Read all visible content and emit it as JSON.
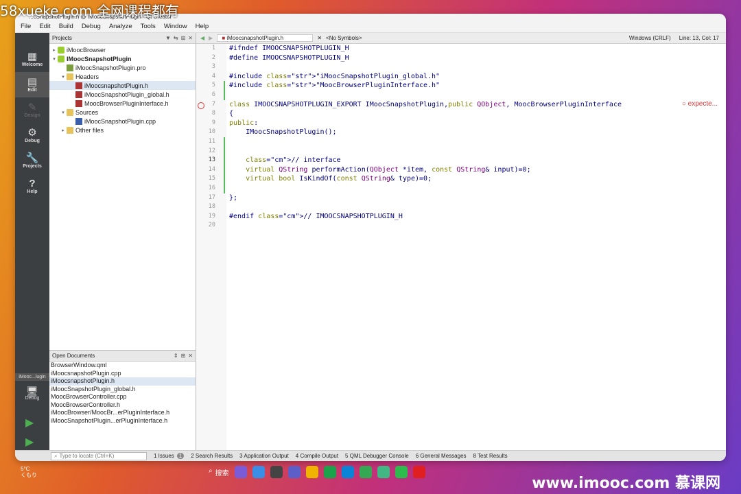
{
  "watermark_top": "58xueke.com 全网课程都有",
  "window_title": "...cSnapshotPlugin.h @ IMoocSnapshotPlugin - Qt Creator",
  "menu": [
    "File",
    "Edit",
    "Build",
    "Debug",
    "Analyze",
    "Tools",
    "Window",
    "Help"
  ],
  "modes": [
    {
      "label": "Welcome",
      "icon": "▦"
    },
    {
      "label": "Edit",
      "icon": "▤"
    },
    {
      "label": "Design",
      "icon": "✎"
    },
    {
      "label": "Debug",
      "icon": "⚙"
    },
    {
      "label": "Projects",
      "icon": "🔧"
    },
    {
      "label": "Help",
      "icon": "?"
    }
  ],
  "kit": {
    "label": "iMooc...lugin",
    "mode": "Debug"
  },
  "projects_panel": {
    "title": "Projects"
  },
  "tree": [
    {
      "text": "iMoocBrowser",
      "indent": 0,
      "arrow": "▸",
      "icon": "project"
    },
    {
      "text": "IMoocSnapshotPlugin",
      "indent": 0,
      "arrow": "▾",
      "icon": "project",
      "bold": true
    },
    {
      "text": "iMoocSnapshotPlugin.pro",
      "indent": 1,
      "arrow": "",
      "icon": "profile"
    },
    {
      "text": "Headers",
      "indent": 1,
      "arrow": "▾",
      "icon": "folder"
    },
    {
      "text": "iMoocsnapshotPlugin.h",
      "indent": 2,
      "arrow": "",
      "icon": "hfile",
      "selected": true
    },
    {
      "text": "iMoocSnapshotPlugin_global.h",
      "indent": 2,
      "arrow": "",
      "icon": "hfile"
    },
    {
      "text": "MoocBrowserPluginInterface.h",
      "indent": 2,
      "arrow": "",
      "icon": "hfile"
    },
    {
      "text": "Sources",
      "indent": 1,
      "arrow": "▾",
      "icon": "folder"
    },
    {
      "text": "iMoocSnapshotPlugin.cpp",
      "indent": 2,
      "arrow": "",
      "icon": "cppfile"
    },
    {
      "text": "Other files",
      "indent": 1,
      "arrow": "▸",
      "icon": "folder"
    }
  ],
  "open_documents": {
    "title": "Open Documents",
    "items": [
      "BrowserWindow.qml",
      "iMoocsnapshotPlugin.cpp",
      "iMoocsnapshotPlugin.h",
      "iMoocSnapshotPlugin_global.h",
      "MoocBrowserController.cpp",
      "MoocBrowserController.h",
      "iMoocBrowser/MoocBr...erPluginInterface.h",
      "iMoocSnapshotPlugin...erPluginInterface.h"
    ]
  },
  "editor": {
    "file": "iMoocsnapshotPlugin.h",
    "symbols": "<No Symbols>",
    "line_ending": "Windows (CRLF)",
    "position": "Line: 13, Col: 17",
    "error_hint": "expecte...",
    "current_line": 13,
    "lines": [
      "#ifndef IMOOCSNAPSHOTPLUGIN_H",
      "#define IMOOCSNAPSHOTPLUGIN_H",
      "",
      "#include \"iMoocSnapshotPlugin_global.h\"",
      "#include \"MoocBrowserPluginInterface.h\"",
      "",
      "class IMOOCSNAPSHOTPLUGIN_EXPORT IMoocSnapshotPlugin,public QObject, MoocBrowserPluginInterface",
      "{",
      "public:",
      "    IMoocSnapshotPlugin();",
      "",
      "",
      "    // interface",
      "    virtual QString performAction(QObject *item, const QString& input)=0;",
      "    virtual bool IsKindOf(const QString& type)=0;",
      "",
      "};",
      "",
      "#endif // IMOOCSNAPSHOTPLUGIN_H",
      ""
    ]
  },
  "status_bar": {
    "locator_placeholder": "Type to locate (Ctrl+K)",
    "tabs": [
      "1  Issues",
      "2  Search Results",
      "3  Application Output",
      "4  Compile Output",
      "5  QML Debugger Console",
      "6  General Messages",
      "8  Test Results"
    ],
    "issues_count": "1"
  },
  "taskbar": {
    "weather_temp": "5°C",
    "weather_desc": "くもり",
    "search_label": "搜索"
  },
  "brand": "www.imooc.com 慕课网",
  "bg_watermark": "58xueke.com"
}
